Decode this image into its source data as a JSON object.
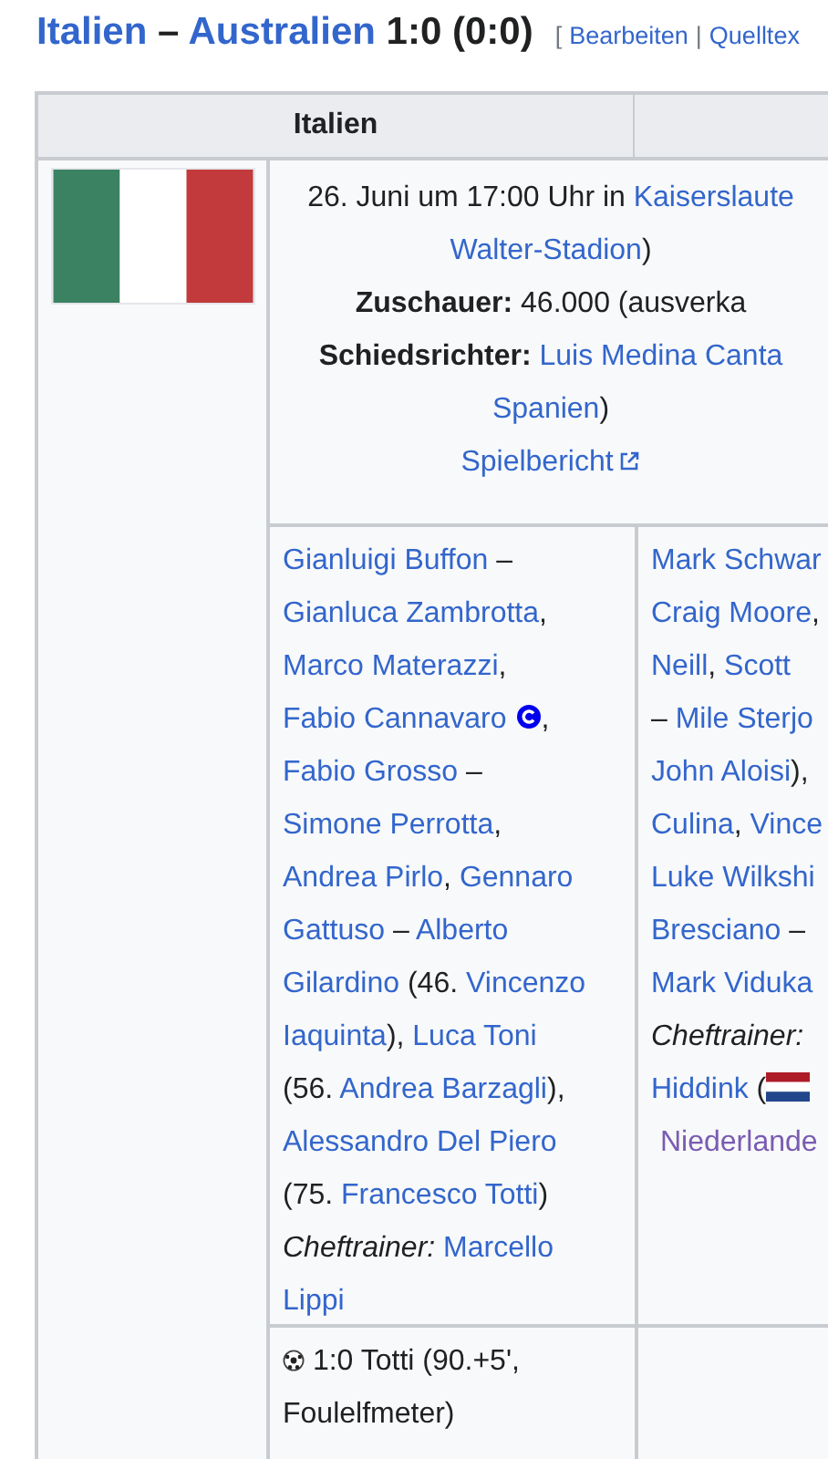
{
  "heading": {
    "segments": [
      {
        "kind": "link",
        "text": "Italien"
      },
      {
        "kind": "plain",
        "text": " – "
      },
      {
        "kind": "link",
        "text": "Australien"
      },
      {
        "kind": "plain",
        "text": " 1:0 (0:0)"
      }
    ]
  },
  "edit_links": [
    {
      "kind": "plain",
      "text": "["
    },
    {
      "kind": "link",
      "text": "Bearbeiten"
    },
    {
      "kind": "plain",
      "text": "|"
    },
    {
      "kind": "link",
      "text": "Quelltex"
    }
  ],
  "table": {
    "headers": [
      "Italien"
    ],
    "info_lines": [
      [
        {
          "kind": "plain",
          "text": "26. Juni um 17:00 Uhr in "
        },
        {
          "kind": "link",
          "text": "Kaiserslaute"
        }
      ],
      [
        {
          "kind": "link",
          "text": "Walter-Stadion"
        },
        {
          "kind": "plain",
          "text": ")"
        }
      ],
      [
        {
          "kind": "bold",
          "text": "Zuschauer:"
        },
        {
          "kind": "plain",
          "text": " 46.000 (ausverka"
        }
      ],
      [
        {
          "kind": "bold",
          "text": "Schiedsrichter: "
        },
        {
          "kind": "link",
          "text": "Luis Medina Canta"
        }
      ],
      [
        {
          "kind": "link",
          "text": "Spanien"
        },
        {
          "kind": "plain",
          "text": ")"
        }
      ],
      [
        {
          "kind": "external",
          "text": "Spielbericht"
        }
      ]
    ],
    "lineup_italy": [
      [
        {
          "kind": "link",
          "text": "Gianluigi Buffon"
        },
        {
          "kind": "plain",
          "text": " –"
        }
      ],
      [
        {
          "kind": "link",
          "text": "Gianluca Zambrotta"
        },
        {
          "kind": "plain",
          "text": ","
        }
      ],
      [
        {
          "kind": "link",
          "text": "Marco Materazzi"
        },
        {
          "kind": "plain",
          "text": ","
        }
      ],
      [
        {
          "kind": "link",
          "text": "Fabio Cannavaro"
        },
        {
          "kind": "captain"
        },
        {
          "kind": "plain",
          "text": ","
        }
      ],
      [
        {
          "kind": "link",
          "text": "Fabio Grosso"
        },
        {
          "kind": "plain",
          "text": " –"
        }
      ],
      [
        {
          "kind": "link",
          "text": "Simone Perrotta"
        },
        {
          "kind": "plain",
          "text": ","
        }
      ],
      [
        {
          "kind": "link",
          "text": "Andrea Pirlo"
        },
        {
          "kind": "plain",
          "text": ", "
        },
        {
          "kind": "link",
          "text": "Gennaro"
        }
      ],
      [
        {
          "kind": "link",
          "text": "Gattuso"
        },
        {
          "kind": "plain",
          "text": " – "
        },
        {
          "kind": "link",
          "text": "Alberto"
        }
      ],
      [
        {
          "kind": "link",
          "text": "Gilardino"
        },
        {
          "kind": "plain",
          "text": " (46. "
        },
        {
          "kind": "link",
          "text": "Vincenzo"
        }
      ],
      [
        {
          "kind": "link",
          "text": "Iaquinta"
        },
        {
          "kind": "plain",
          "text": "), "
        },
        {
          "kind": "link",
          "text": "Luca Toni"
        }
      ],
      [
        {
          "kind": "plain",
          "text": "(56. "
        },
        {
          "kind": "link",
          "text": "Andrea Barzagli"
        },
        {
          "kind": "plain",
          "text": "),"
        }
      ],
      [
        {
          "kind": "link",
          "text": "Alessandro Del Piero"
        }
      ],
      [
        {
          "kind": "plain",
          "text": "(75. "
        },
        {
          "kind": "link",
          "text": "Francesco Totti"
        },
        {
          "kind": "plain",
          "text": ")"
        }
      ],
      [
        {
          "kind": "italic",
          "text": "Cheftrainer: "
        },
        {
          "kind": "link",
          "text": "Marcello"
        }
      ],
      [
        {
          "kind": "link",
          "text": "Lippi"
        }
      ]
    ],
    "lineup_australia": [
      [
        {
          "kind": "link",
          "text": "Mark Schwar"
        }
      ],
      [
        {
          "kind": "link",
          "text": "Craig Moore"
        },
        {
          "kind": "plain",
          "text": ","
        }
      ],
      [
        {
          "kind": "link",
          "text": "Neill"
        },
        {
          "kind": "plain",
          "text": ", "
        },
        {
          "kind": "link",
          "text": "Scott"
        }
      ],
      [
        {
          "kind": "plain",
          "text": "– "
        },
        {
          "kind": "link",
          "text": "Mile Sterjo"
        }
      ],
      [
        {
          "kind": "link",
          "text": "John Aloisi"
        },
        {
          "kind": "plain",
          "text": "),"
        }
      ],
      [
        {
          "kind": "link",
          "text": "Culina"
        },
        {
          "kind": "plain",
          "text": ", "
        },
        {
          "kind": "link",
          "text": "Vince"
        }
      ],
      [
        {
          "kind": "link",
          "text": "Luke Wilkshi"
        }
      ],
      [
        {
          "kind": "link",
          "text": "Bresciano"
        },
        {
          "kind": "plain",
          "text": " –"
        }
      ],
      [
        {
          "kind": "link",
          "text": "Mark Viduka"
        }
      ],
      [
        {
          "kind": "italic",
          "text": "Cheftrainer:"
        }
      ],
      [
        {
          "kind": "link",
          "text": "Hiddink"
        },
        {
          "kind": "plain",
          "text": " ("
        },
        {
          "kind": "nl-flag"
        }
      ],
      [
        {
          "kind": "visited",
          "text": "Niederlande"
        }
      ]
    ],
    "goals_italy": [
      [
        {
          "kind": "ball"
        },
        {
          "kind": "plain",
          "text": " 1:0 Totti (90.+5',"
        }
      ],
      [
        {
          "kind": "plain",
          "text": "Foulelfmeter)"
        }
      ]
    ]
  }
}
